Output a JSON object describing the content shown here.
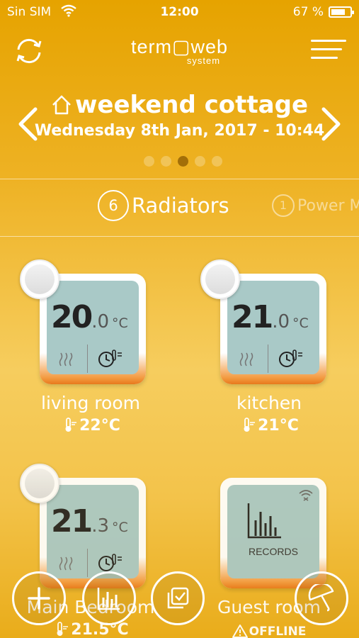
{
  "status": {
    "carrier": "Sin SIM",
    "time": "12:00",
    "battery": "67 %",
    "battery_level": 0.67
  },
  "header": {
    "brand": "term▢web",
    "brand_sub": "system"
  },
  "location": {
    "name": "weekend cottage",
    "datetime": "Wednesday 8th Jan, 2017 - 10:44",
    "page_count": 5,
    "active_page": 3
  },
  "tabs": [
    {
      "count": "6",
      "label": "Radiators"
    },
    {
      "count": "1",
      "label": "Power M"
    }
  ],
  "devices": [
    {
      "name": "living room",
      "temp_int": "20",
      "temp_dec": ".0",
      "unit": "°C",
      "ambient": "22°C"
    },
    {
      "name": "kitchen",
      "temp_int": "21",
      "temp_dec": ".0",
      "unit": "°C",
      "ambient": "21°C"
    },
    {
      "name": "Main Bedroom",
      "temp_int": "21",
      "temp_dec": ".3",
      "unit": "°C",
      "ambient": "21.5°C"
    },
    {
      "name": "Guest room",
      "records_label": "RECORDS",
      "status": "OFFLINE"
    }
  ],
  "colors": {
    "background": "#eeb224",
    "card_screen": "#a9c9c7",
    "card_accent": "#e8791c"
  },
  "icons": {
    "refresh": "refresh-icon",
    "menu": "hamburger-menu-icon",
    "home": "home-icon",
    "add": "plus-icon",
    "stats": "bar-chart-icon",
    "select": "checkbox-stack-icon",
    "away": "umbrella-icon"
  }
}
